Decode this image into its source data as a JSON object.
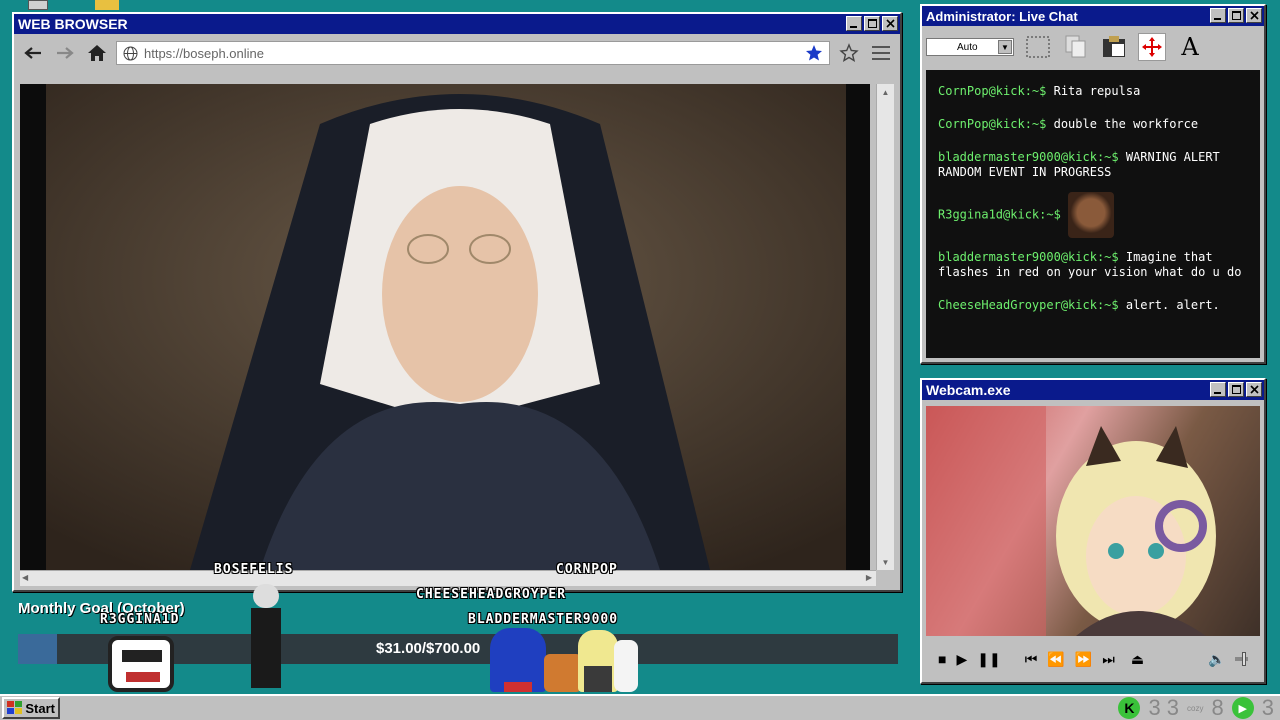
{
  "browser": {
    "title": "WEB BROWSER",
    "url": "https://boseph.online"
  },
  "chat": {
    "title": "Administrator: Live Chat",
    "font_select": "Auto",
    "messages": [
      {
        "user": "CornPop@kick:~$",
        "text": "Rita repulsa"
      },
      {
        "user": "CornPop@kick:~$",
        "text": "double the workforce"
      },
      {
        "user": "bladdermaster9000@kick:~$",
        "text": "WARNING ALERT RANDOM EVENT IN PROGRESS"
      },
      {
        "user": "R3ggina1d@kick:~$",
        "text": ""
      },
      {
        "user": "bladdermaster9000@kick:~$",
        "text": "Imagine that flashes in red on your vision what do u do"
      },
      {
        "user": "CheeseHeadGroyper@kick:~$",
        "text": "alert. alert."
      }
    ],
    "colors": {
      "user": "#6ef06e",
      "background": "#101010"
    }
  },
  "webcam": {
    "title": "Webcam.exe"
  },
  "overlay": {
    "goal_title": "Monthly Goal (October)",
    "goal_amount": "$31.00/$700.00",
    "goal_progress": 0.044,
    "usernames": {
      "u1": "BOSEFELIS",
      "u2": "CORNPOP",
      "u3": "CHEESEHEADGROYPER",
      "u4": "R3GGINA1D",
      "u5": "BLADDERMASTER9000"
    }
  },
  "taskbar": {
    "start_label": "Start",
    "tray_a": "3 3",
    "tray_b": "8",
    "tray_c": "3",
    "tray_cozy": "cozy"
  }
}
